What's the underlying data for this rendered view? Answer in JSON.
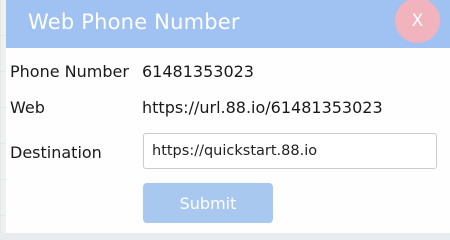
{
  "dialog": {
    "title": "Web Phone Number",
    "close_label": "X"
  },
  "fields": {
    "phone_number": {
      "label": "Phone Number",
      "value": "61481353023"
    },
    "web": {
      "label": "Web",
      "value": "https://url.88.io/61481353023"
    },
    "destination": {
      "label": "Destination",
      "value": "https://quickstart.88.io"
    }
  },
  "actions": {
    "submit_label": "Submit"
  },
  "colors": {
    "header": "#9fc2f2",
    "close_button": "#f1b3bd",
    "submit_button": "#a8c8f0"
  }
}
